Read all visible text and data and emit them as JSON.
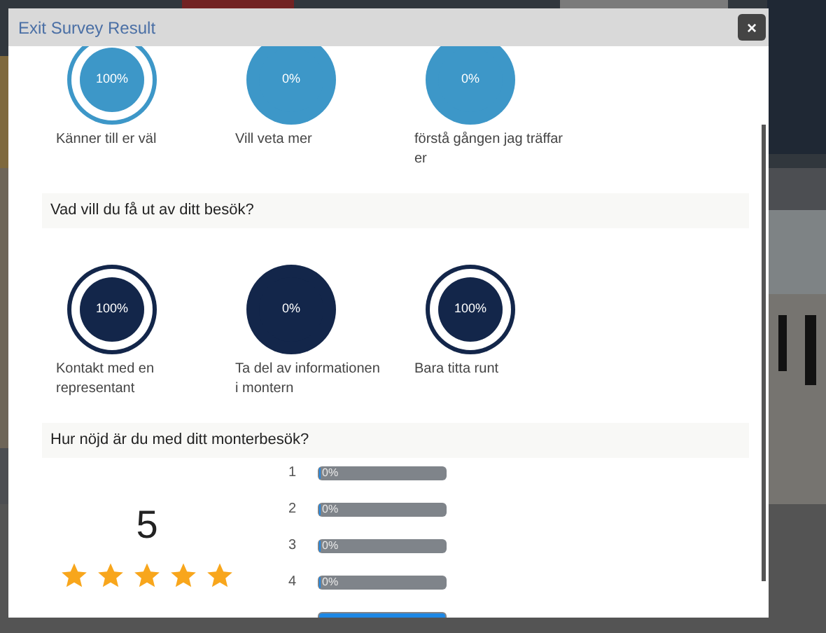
{
  "modal": {
    "title": "Exit Survey Result",
    "close": "×"
  },
  "questions": [
    {
      "color": "#3d97c8",
      "options": [
        {
          "label": "Känner till er väl",
          "value": "100%",
          "selected": true
        },
        {
          "label": "Vill veta mer",
          "value": "0%",
          "selected": false
        },
        {
          "label": "förstå gången jag träffar er",
          "value": "0%",
          "selected": false
        }
      ]
    },
    {
      "title": "Vad vill du få ut av ditt besök?",
      "color": "#13264a",
      "options": [
        {
          "label": "Kontakt med en representant",
          "value": "100%",
          "selected": true
        },
        {
          "label": "Ta del av informationen i montern",
          "value": "0%",
          "selected": false
        },
        {
          "label": "Bara titta runt",
          "value": "100%",
          "selected": true
        }
      ]
    }
  ],
  "rating": {
    "title": "Hur nöjd är du med ditt monterbesök?",
    "average": "5",
    "stars": 5,
    "rows": [
      {
        "label": "1",
        "value": "0%",
        "level": 0
      },
      {
        "label": "2",
        "value": "0%",
        "level": 0
      },
      {
        "label": "3",
        "value": "0%",
        "level": 0
      },
      {
        "label": "4",
        "value": "0%",
        "level": 0
      },
      {
        "level": 1
      }
    ]
  }
}
